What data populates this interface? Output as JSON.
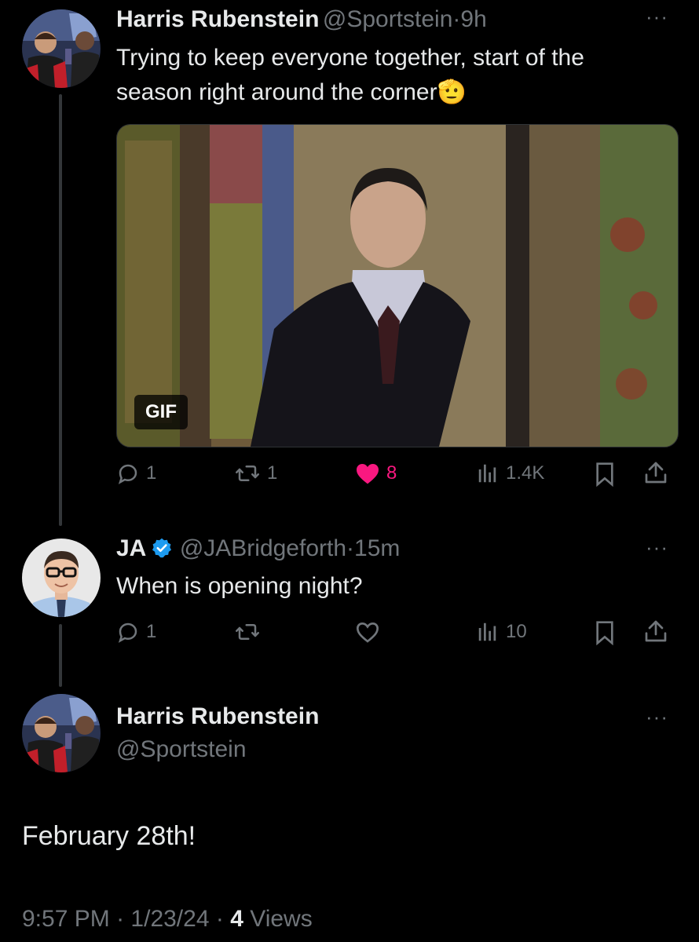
{
  "tweet1": {
    "name": "Harris Rubenstein",
    "handle": "@Sportstein",
    "time": "9h",
    "text_line1": "Trying to keep everyone together, start of the",
    "text_line2": "season right around the corner",
    "emoji": "🫡",
    "gif_label": "GIF",
    "replies": "1",
    "retweets": "1",
    "likes": "8",
    "views": "1.4K"
  },
  "tweet2": {
    "name": "JA",
    "handle": "@JABridgeforth",
    "time": "15m",
    "text": "When is opening night?",
    "replies": "1",
    "views": "10"
  },
  "main_tweet": {
    "name": "Harris Rubenstein",
    "handle": "@Sportstein",
    "text": "February 28th!",
    "time": "9:57 PM",
    "date": "1/23/24",
    "views_count": "4",
    "views_label": "Views"
  },
  "separator": "·",
  "icons": {
    "reply": "reply-icon",
    "retweet": "retweet-icon",
    "like": "heart-icon",
    "views": "analytics-icon",
    "bookmark": "bookmark-icon",
    "share": "share-icon",
    "more": "more-icon",
    "verified": "verified-badge-icon"
  },
  "colors": {
    "background": "#000000",
    "text": "#e7e9ea",
    "muted": "#71767b",
    "like_pink": "#f91880",
    "verified_blue": "#1d9bf0"
  }
}
